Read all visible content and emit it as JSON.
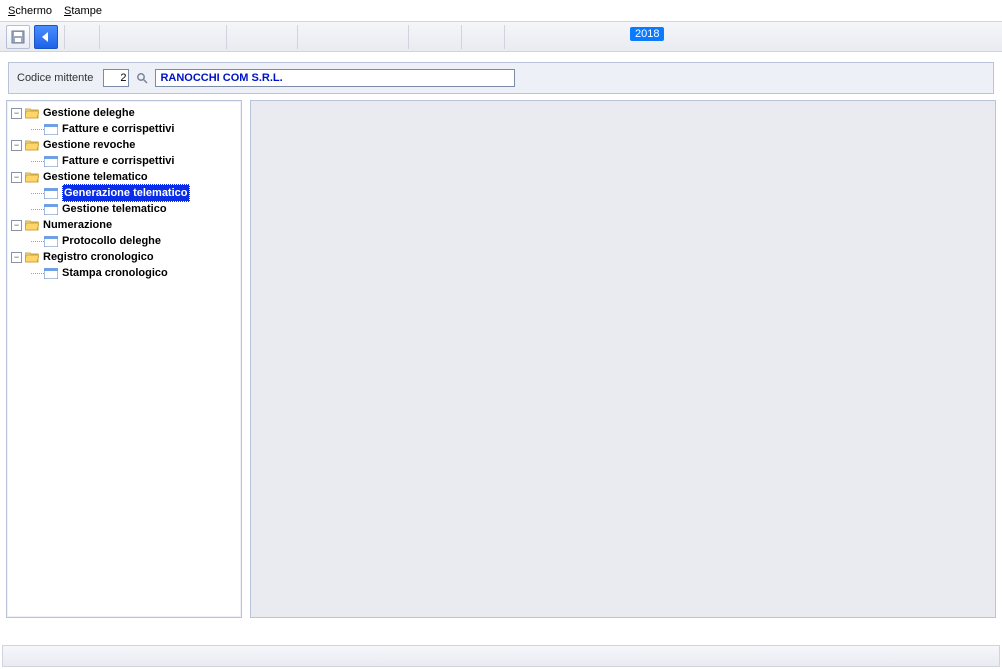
{
  "menu": {
    "schermo": "Schermo",
    "stampe": "Stampe"
  },
  "toolbar": {
    "year": "2018"
  },
  "form": {
    "label": "Codice mittente",
    "code": "2",
    "name": "RANOCCHI COM S.R.L."
  },
  "tree": {
    "n0": "Gestione deleghe",
    "n0a": "Fatture e corrispettivi",
    "n1": "Gestione revoche",
    "n1a": "Fatture e corrispettivi",
    "n2": "Gestione telematico",
    "n2a": "Generazione telematico",
    "n2b": "Gestione telematico",
    "n3": "Numerazione",
    "n3a": "Protocollo deleghe",
    "n4": "Registro cronologico",
    "n4a": "Stampa cronologico"
  }
}
